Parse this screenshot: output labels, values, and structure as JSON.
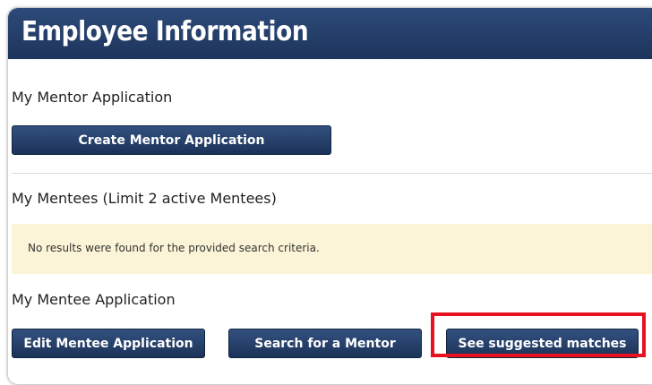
{
  "header": {
    "title": "Employee Information"
  },
  "mentor_application": {
    "heading": "My Mentor Application",
    "create_button": "Create Mentor Application"
  },
  "mentees": {
    "heading": "My Mentees (Limit 2 active Mentees)",
    "empty_message": "No results were found for the provided search criteria."
  },
  "mentee_application": {
    "heading": "My Mentee Application",
    "edit_button": "Edit Mentee Application",
    "search_button": "Search for a Mentor",
    "suggested_button": "See suggested matches"
  },
  "colors": {
    "header_bg": "#1f3a66",
    "button_bg": "#1f3a66",
    "alert_bg": "#fcf4d6",
    "highlight": "#e8111f"
  }
}
